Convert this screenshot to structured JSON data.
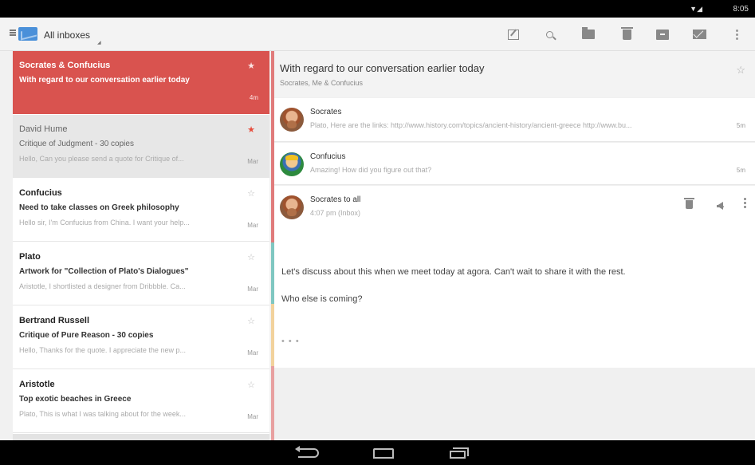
{
  "status": {
    "time": "8:05",
    "signal": "▼◢"
  },
  "topbar": {
    "title": "All inboxes"
  },
  "messages": [
    {
      "from": "Socrates & Confucius",
      "subject": "With regard to our conversation earlier today",
      "preview": "",
      "time": "4m",
      "star": "★",
      "state": "selected"
    },
    {
      "from": "David Hume",
      "subject": "Critique of Judgment - 30 copies",
      "preview": "Hello, Can you please send a quote for Critique of...",
      "time": "Mar",
      "star": "★",
      "state": "read"
    },
    {
      "from": "Confucius",
      "subject": "Need to take classes on Greek philosophy",
      "preview": "Hello sir, I'm Confucius from China. I want your help...",
      "time": "Mar",
      "star": "☆",
      "state": "unread"
    },
    {
      "from": "Plato",
      "subject": "Artwork for \"Collection of Plato's Dialogues\"",
      "preview": "Aristotle, I shortlisted a designer from Dribbble. Ca...",
      "time": "Mar",
      "star": "☆",
      "state": "unread"
    },
    {
      "from": "Bertrand Russell",
      "subject": "Critique of Pure Reason - 30 copies",
      "preview": "Hello, Thanks for the quote. I appreciate the new p...",
      "time": "Mar",
      "star": "☆",
      "state": "unread"
    },
    {
      "from": "Aristotle",
      "subject": "Top exotic beaches in Greece",
      "preview": "Plato, This is what I was talking about for the week...",
      "time": "Mar",
      "star": "☆",
      "state": "unread"
    }
  ],
  "thread": {
    "subject": "With regard to our conversation earlier today",
    "participants": "Socrates, Me & Confucius",
    "star": "☆",
    "collapsed": [
      {
        "sender": "Socrates",
        "snippet": "Plato, Here are the links: http://www.history.com/topics/ancient-history/ancient-greece http://www.bu...",
        "time": "5m",
        "avatar": "socrates"
      },
      {
        "sender": "Confucius",
        "snippet": "Amazing! How did you figure out that?",
        "time": "5m",
        "avatar": "confucius"
      }
    ],
    "open": {
      "sender": "Socrates to all",
      "received": "4:07 pm (Inbox)",
      "body1": "Let's discuss about this when we meet today at agora. Can't wait to share it with the rest.",
      "body2": "Who else is coming?",
      "ellipsis": "• • •"
    }
  }
}
